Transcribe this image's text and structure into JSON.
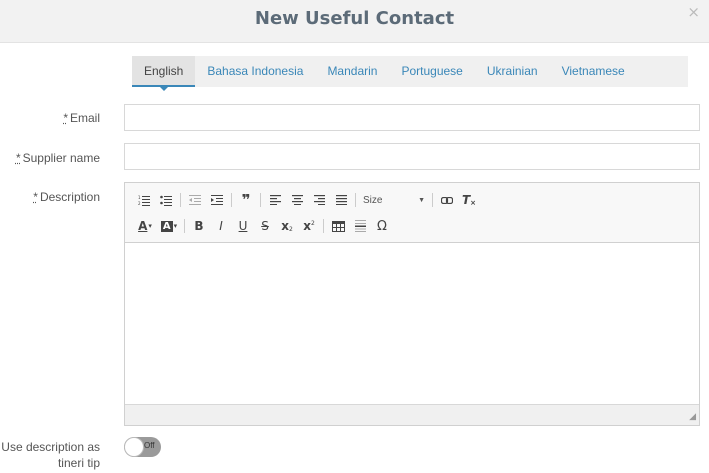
{
  "modal": {
    "title": "New Useful Contact",
    "close": "×"
  },
  "tabs": [
    {
      "label": "English"
    },
    {
      "label": "Bahasa Indonesia"
    },
    {
      "label": "Mandarin"
    },
    {
      "label": "Portuguese"
    },
    {
      "label": "Ukrainian"
    },
    {
      "label": "Vietnamese"
    }
  ],
  "form": {
    "required_marker": "*",
    "email_label": "Email",
    "email_value": "",
    "supplier_label": "Supplier name",
    "supplier_value": "",
    "description_label": "Description",
    "use_desc_label_line1": "Use description as",
    "use_desc_label_line2": "tineri tip",
    "toggle_state": "Off"
  },
  "editor": {
    "toolbar": {
      "blockquote": "❞",
      "size_label": "Size",
      "remove_format": "T",
      "text_color": "A",
      "bg_color": "A",
      "bold": "B",
      "italic": "I",
      "underline": "U",
      "strike": "S",
      "subscript": "x",
      "superscript": "x",
      "special_char": "Ω"
    },
    "grip": "◢"
  }
}
